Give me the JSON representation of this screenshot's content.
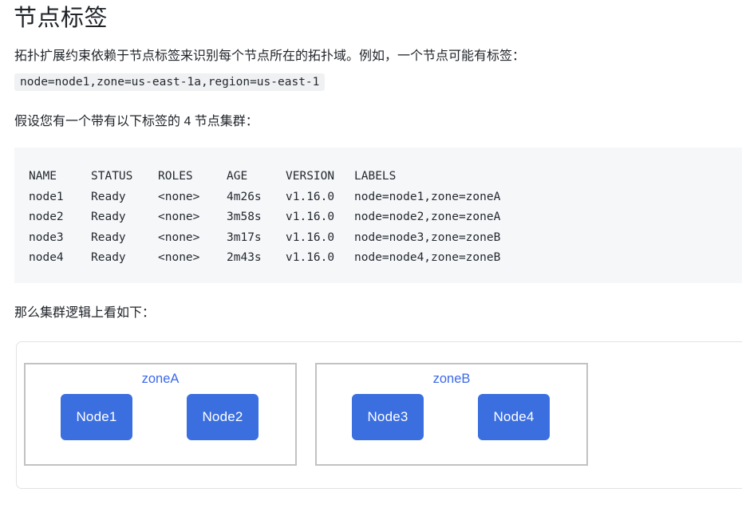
{
  "page": {
    "title": "节点标签"
  },
  "intro": {
    "paragraph_1": "拓扑扩展约束依赖于节点标签来识别每个节点所在的拓扑域。例如，一个节点可能有标签：",
    "inline_code": "node=node1,zone=us-east-1a,region=us-east-1",
    "paragraph_2": "假设您有一个带有以下标签的 4 节点集群：",
    "paragraph_3": "那么集群逻辑上看如下："
  },
  "node_table": {
    "headers": [
      "NAME",
      "STATUS",
      "ROLES",
      "AGE",
      "VERSION",
      "LABELS"
    ],
    "rows": [
      [
        "node1",
        "Ready",
        "<none>",
        "4m26s",
        "v1.16.0",
        "node=node1,zone=zoneA"
      ],
      [
        "node2",
        "Ready",
        "<none>",
        "3m58s",
        "v1.16.0",
        "node=node2,zone=zoneA"
      ],
      [
        "node3",
        "Ready",
        "<none>",
        "3m17s",
        "v1.16.0",
        "node=node3,zone=zoneB"
      ],
      [
        "node4",
        "Ready",
        "<none>",
        "2m43s",
        "v1.16.0",
        "node=node4,zone=zoneB"
      ]
    ]
  },
  "diagram": {
    "zones": [
      {
        "label": "zoneA",
        "nodes": [
          "Node1",
          "Node2"
        ]
      },
      {
        "label": "zoneB",
        "nodes": [
          "Node3",
          "Node4"
        ]
      }
    ]
  },
  "colors": {
    "node_fill": "#3b6fe0",
    "zone_label": "#3b68e8",
    "zone_border": "#c2c2c2",
    "code_background": "#f6f7f9",
    "inline_code_background": "#f0f1f3",
    "text": "#1f2328"
  }
}
